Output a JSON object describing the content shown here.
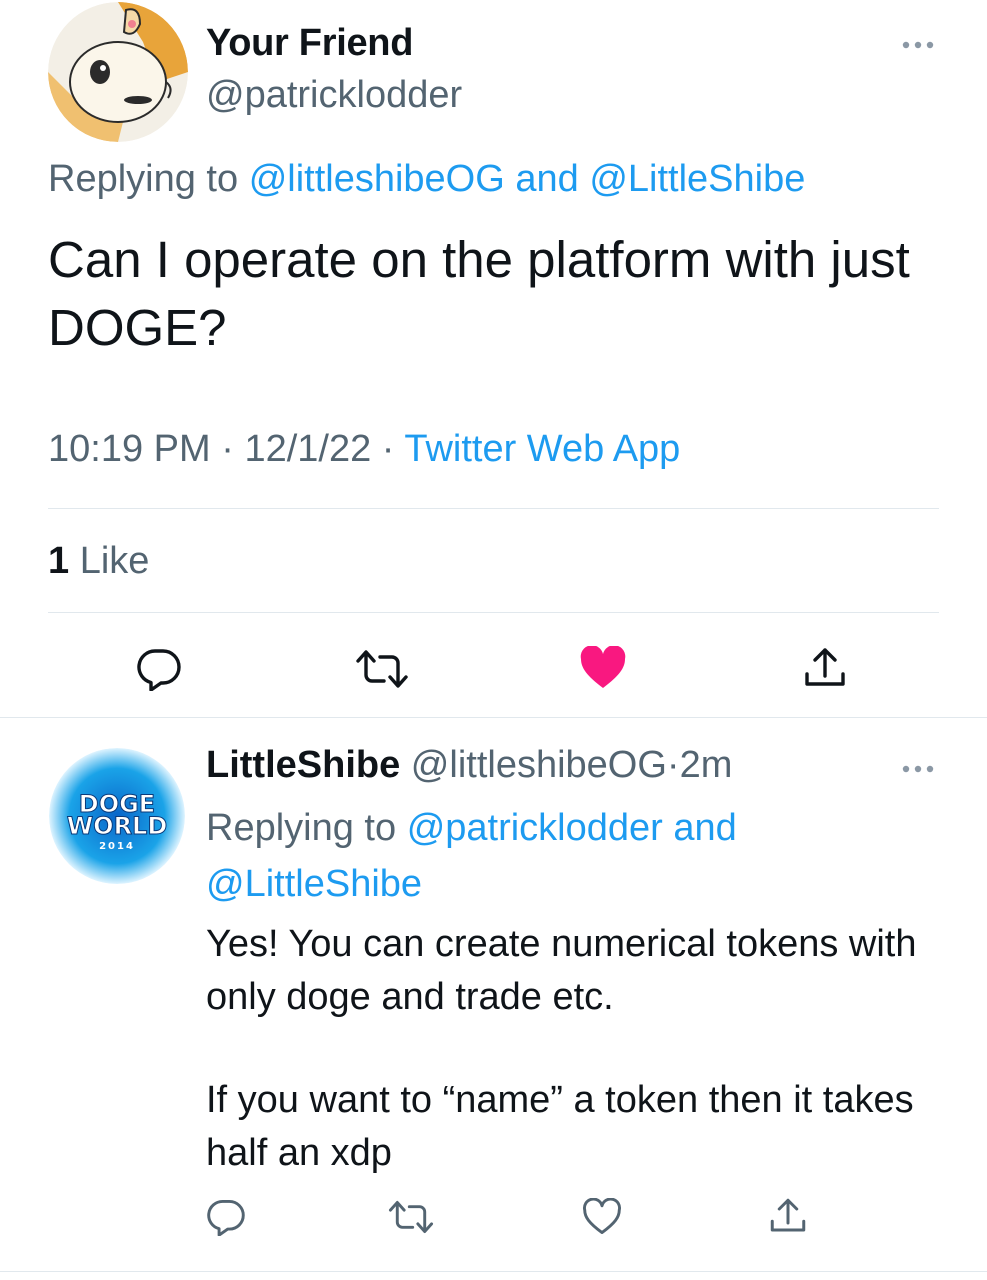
{
  "tweet": {
    "display_name": "Your Friend",
    "handle": "@patricklodder",
    "replying_prefix": "Replying to",
    "replying_to_1": "@littleshibeOG",
    "replying_joiner": "and",
    "replying_to_2": "@LittleShibe",
    "text": "Can I operate on the platform with just DOGE?",
    "time": "10:19 PM",
    "date": "12/1/22",
    "separator": "·",
    "source": "Twitter Web App",
    "like_count": "1",
    "like_label": "Like"
  },
  "reply": {
    "display_name": "LittleShibe",
    "handle": "@littleshibeOG",
    "separator": "·",
    "age": "2m",
    "replying_prefix": "Replying to",
    "replying_to_1": "@patricklodder",
    "replying_joiner": "and",
    "replying_to_2": "@LittleShibe",
    "text_p1": "Yes! You can create numerical tokens with only doge and trade etc.",
    "text_p2": "If you want to “name” a token then it takes half an xdp",
    "avatar_text_1": "DOGE",
    "avatar_text_2": "WORLD",
    "avatar_text_3": "2014"
  },
  "colors": {
    "link": "#1d9bf0",
    "muted": "#536471",
    "like_active": "#f91880",
    "divider": "#e1e8ed"
  },
  "icons": [
    "more-icon",
    "reply-icon",
    "retweet-icon",
    "like-icon-filled",
    "share-icon",
    "like-icon"
  ]
}
